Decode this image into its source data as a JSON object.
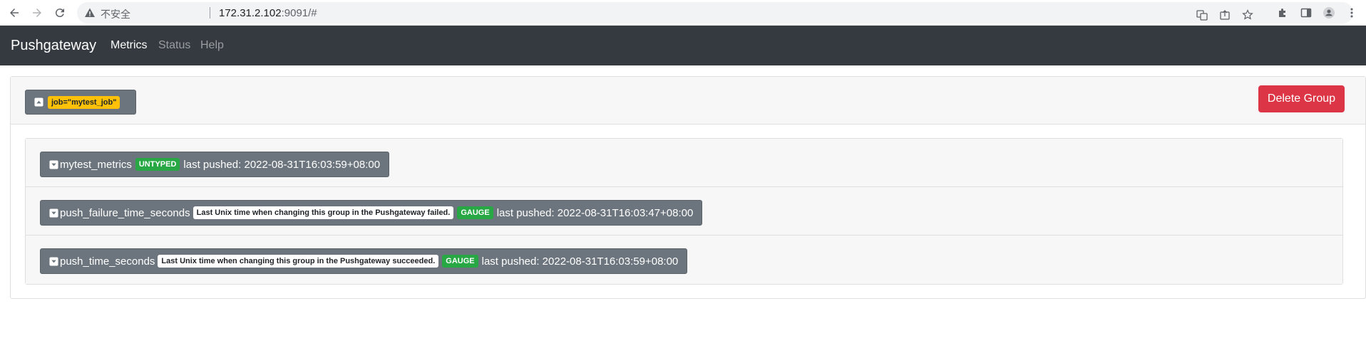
{
  "browser": {
    "insecure_label": "不安全",
    "url_host": "172.31.2.102",
    "url_rest": ":9091/#"
  },
  "navbar": {
    "brand": "Pushgateway",
    "links": [
      {
        "label": "Metrics",
        "active": true
      },
      {
        "label": "Status",
        "active": false
      },
      {
        "label": "Help",
        "active": false
      }
    ]
  },
  "group": {
    "job_label": "job=\"mytest_job\"",
    "delete_label": "Delete Group",
    "metrics": [
      {
        "name": "mytest_metrics",
        "help": "",
        "type": "UNTYPED",
        "last_pushed": "last pushed: 2022-08-31T16:03:59+08:00"
      },
      {
        "name": "push_failure_time_seconds",
        "help": "Last Unix time when changing this group in the Pushgateway failed.",
        "type": "GAUGE",
        "last_pushed": "last pushed: 2022-08-31T16:03:47+08:00"
      },
      {
        "name": "push_time_seconds",
        "help": "Last Unix time when changing this group in the Pushgateway succeeded.",
        "type": "GAUGE",
        "last_pushed": "last pushed: 2022-08-31T16:03:59+08:00"
      }
    ]
  },
  "colors": {
    "navbar": "#343a40",
    "secondary": "#6c757d",
    "danger": "#dc3545",
    "warning": "#ffc107",
    "success": "#28a745"
  }
}
